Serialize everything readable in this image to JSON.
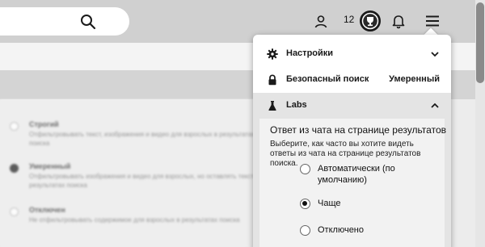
{
  "header": {
    "search_placeholder": "",
    "achievement_count": "12"
  },
  "background_options": [
    {
      "title": "Строгий",
      "desc": "Отфильтровывать текст, изображения и видео для взрослых в результатах поиска",
      "checked": false
    },
    {
      "title": "Умеренный",
      "desc": "Отфильтровывать изображения и видео для взрослых, но оставлять текст в результатах поиска",
      "checked": true
    },
    {
      "title": "Отключен",
      "desc": "Не отфильтровывать содержимое для взрослых в результатах поиска",
      "checked": false
    }
  ],
  "menu": {
    "settings_label": "Настройки",
    "safesearch_label": "Безопасный поиск",
    "safesearch_value": "Умеренный",
    "labs_label": "Labs",
    "chat": {
      "title": "Ответ из чата на странице результатов",
      "description": "Выберите, как часто вы хотите видеть ответы из чата на странице результатов поиска.",
      "options": [
        {
          "label": "Автоматически (по умолчанию)",
          "selected": false
        },
        {
          "label": "Чаще",
          "selected": true
        },
        {
          "label": "Отключено",
          "selected": false
        }
      ]
    }
  },
  "icons": {
    "search": "search-icon",
    "user": "user-icon",
    "achievement": "trophy-icon",
    "notifications": "bell-icon",
    "menu": "hamburger-icon",
    "settings": "gear-icon",
    "safesearch": "lock-icon",
    "labs": "flask-icon"
  }
}
